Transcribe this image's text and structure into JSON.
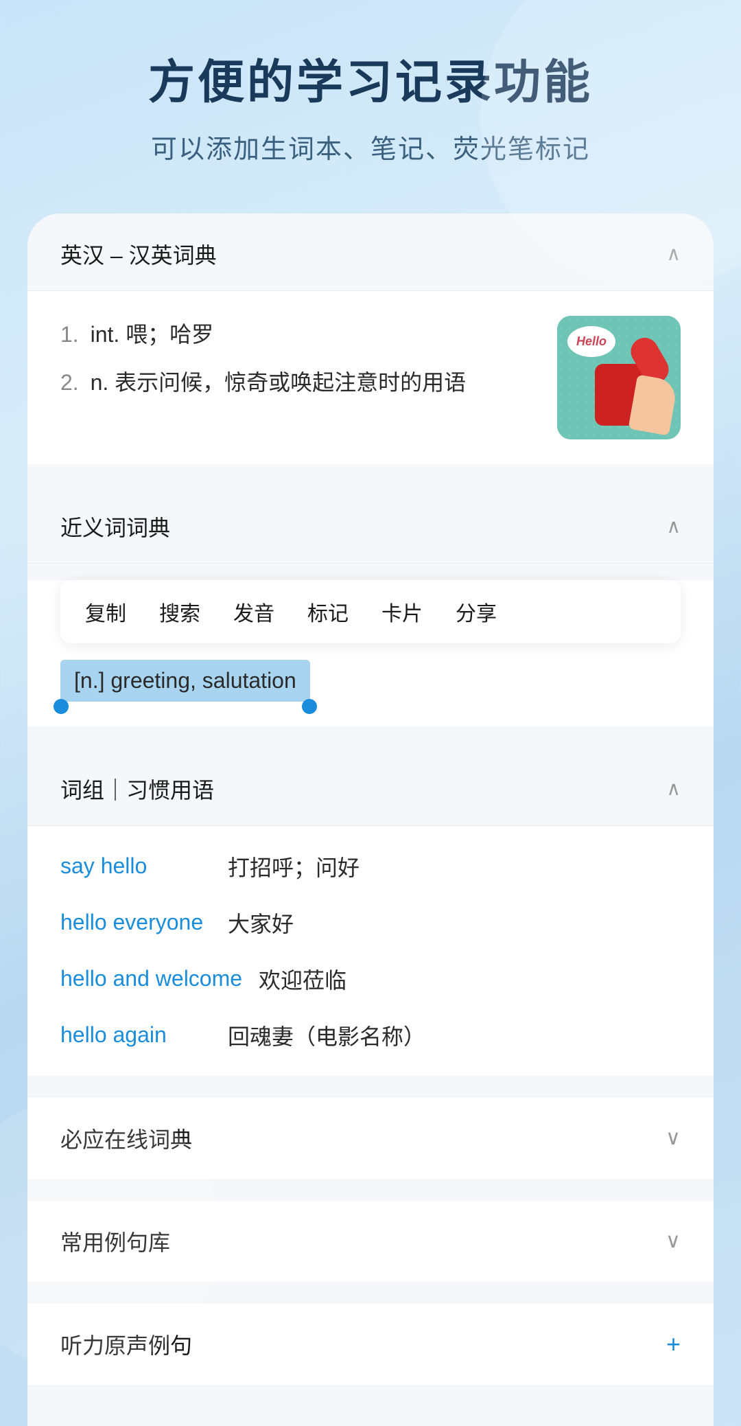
{
  "header": {
    "title": "方便的学习记录功能",
    "subtitle": "可以添加生词本、笔记、荧光笔标记"
  },
  "dictionary_section": {
    "label": "英汉 – 汉英词典",
    "chevron": "∧",
    "definitions": [
      {
        "number": "1.",
        "text": "int. 喂；哈罗"
      },
      {
        "number": "2.",
        "text": "n. 表示问候，惊奇或唤起注意时的用语"
      }
    ],
    "image_label": "Hello telephone illustration"
  },
  "synonym_section": {
    "label": "近义词词典",
    "chevron": "∧",
    "context_menu": {
      "items": [
        "复制",
        "搜索",
        "发音",
        "标记",
        "卡片",
        "分享"
      ]
    },
    "highlighted": "[n.] greeting, salutation"
  },
  "word_group_section": {
    "label": "词组｜习惯用语",
    "chevron": "∧",
    "phrases": [
      {
        "english": "say hello",
        "chinese": "打招呼；问好"
      },
      {
        "english": "hello everyone",
        "chinese": "大家好"
      },
      {
        "english": "hello and welcome",
        "chinese": "欢迎莅临"
      },
      {
        "english": "hello again",
        "chinese": "回魂妻（电影名称）"
      }
    ]
  },
  "collapsed_sections": [
    {
      "label": "必应在线词典",
      "icon": "∨",
      "icon_type": "normal"
    },
    {
      "label": "常用例句库",
      "icon": "∨",
      "icon_type": "normal"
    },
    {
      "label": "听力原声例句",
      "icon": "+",
      "icon_type": "blue"
    }
  ]
}
